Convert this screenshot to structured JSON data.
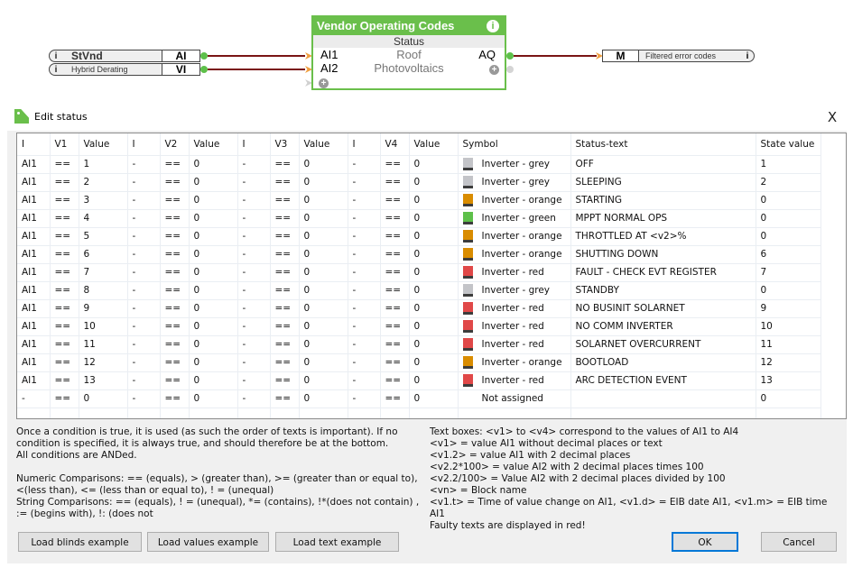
{
  "canvas": {
    "inputs": [
      {
        "name": "StVnd",
        "type": "AI",
        "info_icon": "info-icon"
      },
      {
        "name": "Hybrid Derating",
        "type": "VI",
        "info_icon": "info-icon"
      }
    ],
    "function_block": {
      "title": "Vendor Operating Codes",
      "subtitle": "Status",
      "inputs": [
        "AI1",
        "AI2"
      ],
      "output": "AQ",
      "location_line1": "Roof",
      "location_line2": "Photovoltaics",
      "info_glyph": "i",
      "add_glyph": "+"
    },
    "output": {
      "type": "M",
      "name": "Filtered error codes",
      "info_icon": "info-icon"
    },
    "colors": {
      "block_green": "#6abf4b",
      "wire": "#7a1414",
      "port_orange": "#f0a040"
    }
  },
  "dialog": {
    "title": "Edit status",
    "close_glyph": "X",
    "table": {
      "headers": [
        "I",
        "V1",
        "Value",
        "I",
        "V2",
        "Value",
        "I",
        "V3",
        "Value",
        "I",
        "V4",
        "Value",
        "Symbol",
        "Status-text",
        "State value"
      ],
      "rows": [
        {
          "i1": "AI1",
          "v1": "==",
          "val1": "1",
          "i2": "-",
          "v2": "==",
          "val2": "0",
          "i3": "-",
          "v3": "==",
          "val3": "0",
          "i4": "-",
          "v4": "==",
          "val4": "0",
          "symbol": "Inverter - grey",
          "symbol_color": "grey",
          "status": "OFF",
          "state": "1"
        },
        {
          "i1": "AI1",
          "v1": "==",
          "val1": "2",
          "i2": "-",
          "v2": "==",
          "val2": "0",
          "i3": "-",
          "v3": "==",
          "val3": "0",
          "i4": "-",
          "v4": "==",
          "val4": "0",
          "symbol": "Inverter - grey",
          "symbol_color": "grey",
          "status": "SLEEPING",
          "state": "2"
        },
        {
          "i1": "AI1",
          "v1": "==",
          "val1": "3",
          "i2": "-",
          "v2": "==",
          "val2": "0",
          "i3": "-",
          "v3": "==",
          "val3": "0",
          "i4": "-",
          "v4": "==",
          "val4": "0",
          "symbol": "Inverter - orange",
          "symbol_color": "orange",
          "status": "STARTING",
          "state": "0"
        },
        {
          "i1": "AI1",
          "v1": "==",
          "val1": "4",
          "i2": "-",
          "v2": "==",
          "val2": "0",
          "i3": "-",
          "v3": "==",
          "val3": "0",
          "i4": "-",
          "v4": "==",
          "val4": "0",
          "symbol": "Inverter - green",
          "symbol_color": "green",
          "status": "MPPT NORMAL OPS",
          "state": "0"
        },
        {
          "i1": "AI1",
          "v1": "==",
          "val1": "5",
          "i2": "-",
          "v2": "==",
          "val2": "0",
          "i3": "-",
          "v3": "==",
          "val3": "0",
          "i4": "-",
          "v4": "==",
          "val4": "0",
          "symbol": "Inverter - orange",
          "symbol_color": "orange",
          "status": "THROTTLED AT <v2>%",
          "state": "0"
        },
        {
          "i1": "AI1",
          "v1": "==",
          "val1": "6",
          "i2": "-",
          "v2": "==",
          "val2": "0",
          "i3": "-",
          "v3": "==",
          "val3": "0",
          "i4": "-",
          "v4": "==",
          "val4": "0",
          "symbol": "Inverter - orange",
          "symbol_color": "orange",
          "status": "SHUTTING DOWN",
          "state": "6"
        },
        {
          "i1": "AI1",
          "v1": "==",
          "val1": "7",
          "i2": "-",
          "v2": "==",
          "val2": "0",
          "i3": "-",
          "v3": "==",
          "val3": "0",
          "i4": "-",
          "v4": "==",
          "val4": "0",
          "symbol": "Inverter - red",
          "symbol_color": "red",
          "status": "FAULT - CHECK EVT REGISTER",
          "state": "7"
        },
        {
          "i1": "AI1",
          "v1": "==",
          "val1": "8",
          "i2": "-",
          "v2": "==",
          "val2": "0",
          "i3": "-",
          "v3": "==",
          "val3": "0",
          "i4": "-",
          "v4": "==",
          "val4": "0",
          "symbol": "Inverter - grey",
          "symbol_color": "grey",
          "status": "STANDBY",
          "state": "0"
        },
        {
          "i1": "AI1",
          "v1": "==",
          "val1": "9",
          "i2": "-",
          "v2": "==",
          "val2": "0",
          "i3": "-",
          "v3": "==",
          "val3": "0",
          "i4": "-",
          "v4": "==",
          "val4": "0",
          "symbol": "Inverter - red",
          "symbol_color": "red",
          "status": "NO BUSINIT SOLARNET",
          "state": "9"
        },
        {
          "i1": "AI1",
          "v1": "==",
          "val1": "10",
          "i2": "-",
          "v2": "==",
          "val2": "0",
          "i3": "-",
          "v3": "==",
          "val3": "0",
          "i4": "-",
          "v4": "==",
          "val4": "0",
          "symbol": "Inverter - red",
          "symbol_color": "red",
          "status": "NO COMM INVERTER",
          "state": "10"
        },
        {
          "i1": "AI1",
          "v1": "==",
          "val1": "11",
          "i2": "-",
          "v2": "==",
          "val2": "0",
          "i3": "-",
          "v3": "==",
          "val3": "0",
          "i4": "-",
          "v4": "==",
          "val4": "0",
          "symbol": "Inverter - red",
          "symbol_color": "red",
          "status": "SOLARNET OVERCURRENT",
          "state": "11"
        },
        {
          "i1": "AI1",
          "v1": "==",
          "val1": "12",
          "i2": "-",
          "v2": "==",
          "val2": "0",
          "i3": "-",
          "v3": "==",
          "val3": "0",
          "i4": "-",
          "v4": "==",
          "val4": "0",
          "symbol": "Inverter - orange",
          "symbol_color": "orange",
          "status": "BOOTLOAD",
          "state": "12"
        },
        {
          "i1": "AI1",
          "v1": "==",
          "val1": "13",
          "i2": "-",
          "v2": "==",
          "val2": "0",
          "i3": "-",
          "v3": "==",
          "val3": "0",
          "i4": "-",
          "v4": "==",
          "val4": "0",
          "symbol": "Inverter - red",
          "symbol_color": "red",
          "status": "ARC DETECTION EVENT",
          "state": "13"
        },
        {
          "i1": "-",
          "v1": "==",
          "val1": "0",
          "i2": "-",
          "v2": "==",
          "val2": "0",
          "i3": "-",
          "v3": "==",
          "val3": "0",
          "i4": "-",
          "v4": "==",
          "val4": "0",
          "symbol": "Not assigned",
          "symbol_color": "none",
          "status": "",
          "state": "0"
        }
      ]
    },
    "symbol_colors": {
      "grey": "#c3c4c8",
      "orange": "#d98c00",
      "green": "#5ec04a",
      "red": "#e04848"
    },
    "help_left": [
      "Once a condition is true, it is used (as such the order of texts is important). If no condition is specified, it is always true, and should therefore be at the bottom.",
      "All conditions are ANDed.",
      "",
      "Numeric Comparisons: == (equals), > (greater than), >= (greater than or equal to), <(less than), <= (less than or equal to), ! = (unequal)",
      "String Comparisons: == (equals), ! = (unequal), *= (contains), !*(does not contain) , := (begins with), !: (does not"
    ],
    "help_right": [
      "Text boxes: <v1> to <v4> correspond to the values of AI1 to AI4",
      "<v1> = value AI1 without decimal places or text",
      "<v1.2> = value AI1 with 2 decimal places",
      "<v2.2*100> = value AI2 with 2 decimal places times 100",
      "<v2.2/100> = Value AI2 with 2 decimal places divided by 100",
      "<vn> = Block name",
      "<v1.t> = Time of value change on AI1, <v1.d> = EIB date AI1, <v1.m> = EIB time AI1",
      "Faulty texts are displayed in red!"
    ],
    "buttons": {
      "load_blinds": "Load blinds example",
      "load_values": "Load values example",
      "load_text": "Load text example",
      "ok": "OK",
      "cancel": "Cancel"
    }
  }
}
